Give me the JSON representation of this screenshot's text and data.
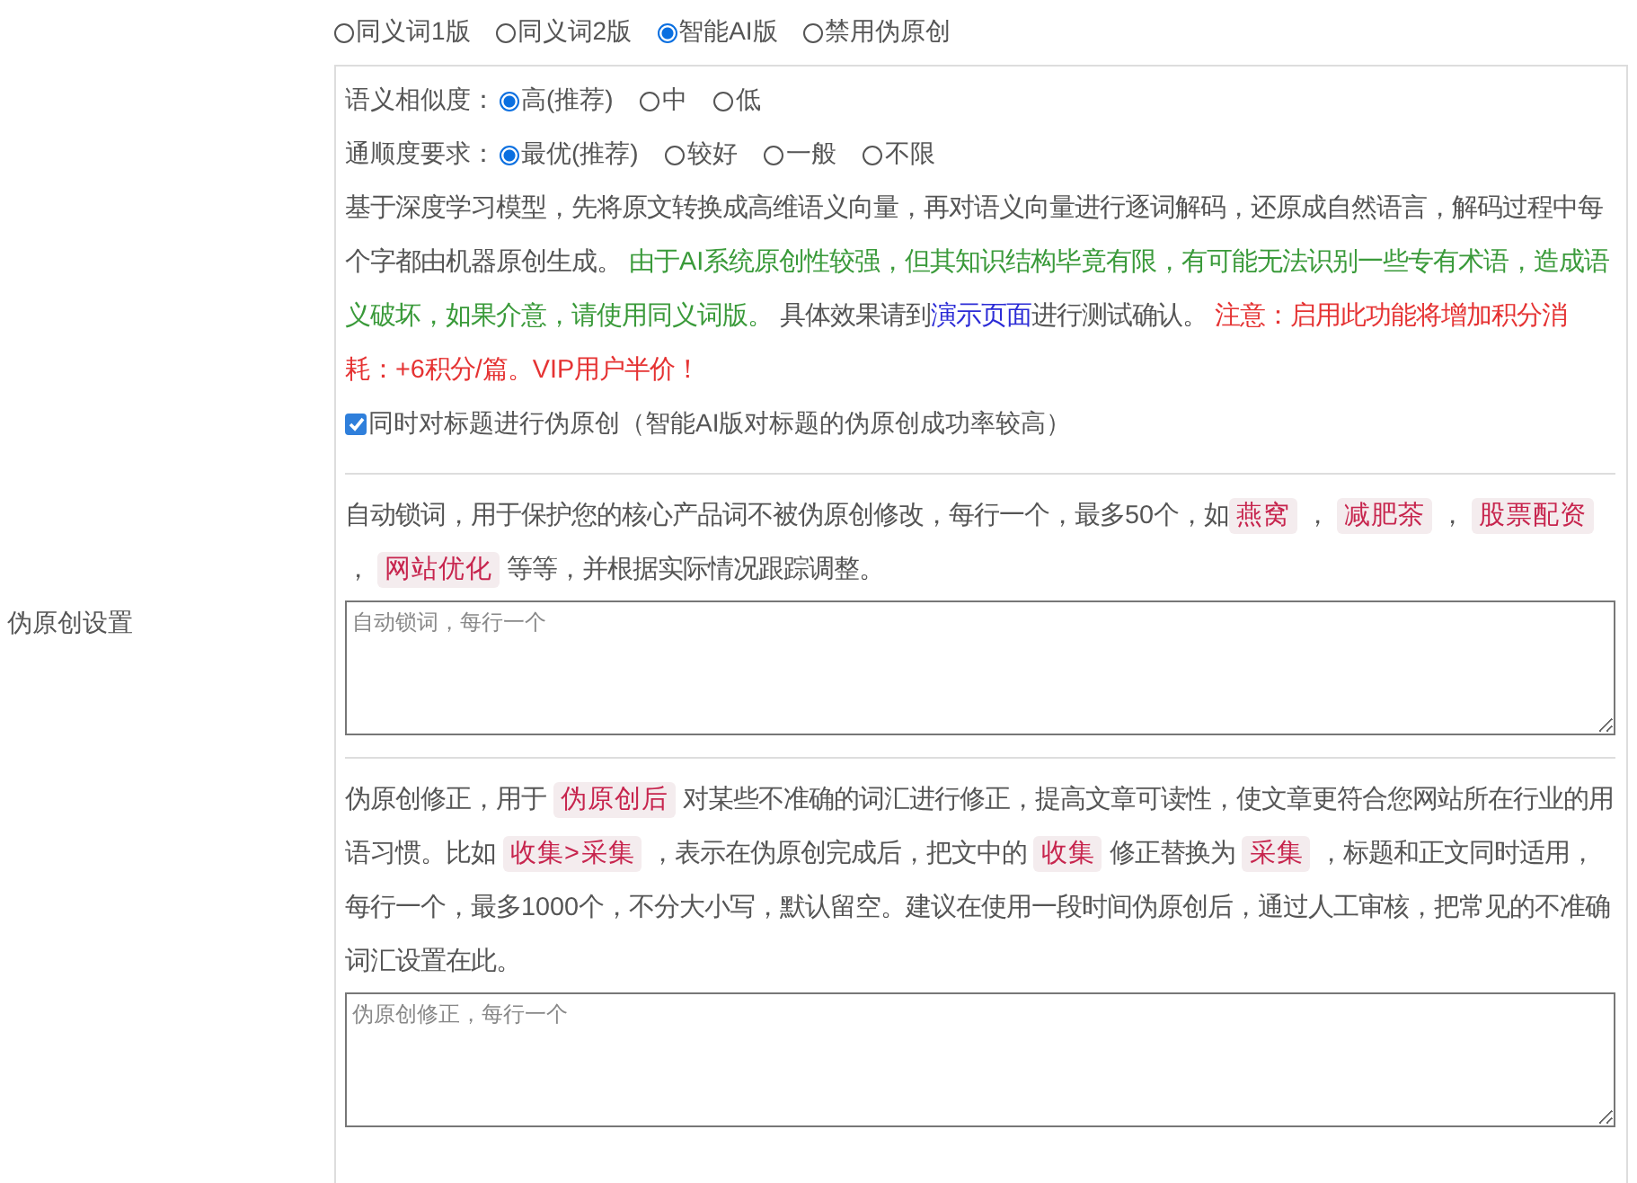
{
  "mode_options": [
    {
      "label": "同义词1版",
      "selected": false
    },
    {
      "label": "同义词2版",
      "selected": false
    },
    {
      "label": "智能AI版",
      "selected": true
    },
    {
      "label": "禁用伪原创",
      "selected": false
    }
  ],
  "section_label": "伪原创设置",
  "settings": [
    {
      "label": "语义相似度：",
      "options": [
        {
          "label": "高(推荐)",
          "selected": true
        },
        {
          "label": "中",
          "selected": false
        },
        {
          "label": "低",
          "selected": false
        }
      ]
    },
    {
      "label": "通顺度要求：",
      "options": [
        {
          "label": "最优(推荐)",
          "selected": true
        },
        {
          "label": "较好",
          "selected": false
        },
        {
          "label": "一般",
          "selected": false
        },
        {
          "label": "不限",
          "selected": false
        }
      ]
    }
  ],
  "description": [
    {
      "kind": "text",
      "text": "基于深度学习模型，先将原文转换成高维语义向量，再对语义向量进行逐词解码，还原成自然语言，解码过程中每个字都由机器原创生成。 "
    },
    {
      "kind": "green",
      "text": "由于AI系统原创性较强，但其知识结构毕竟有限，有可能无法识别一些专有术语，造成语义破坏，如果介意，请使用同义词版。"
    },
    {
      "kind": "text",
      "text": " 具体效果请到"
    },
    {
      "kind": "link",
      "text": "演示页面"
    },
    {
      "kind": "text",
      "text": "进行测试确认。 "
    },
    {
      "kind": "red",
      "text": "注意：启用此功能将增加积分消耗：+6积分/篇。VIP用户半价！"
    }
  ],
  "title_option": {
    "label": "同时对标题进行伪原创（智能AI版对标题的伪原创成功率较高）",
    "checked": true
  },
  "lock_words": {
    "description": [
      {
        "kind": "text",
        "text": "自动锁词，用于保护您的核心产品词不被伪原创修改，每行一个，最多50个，如"
      },
      {
        "kind": "code",
        "text": "燕窝"
      },
      {
        "kind": "text",
        "text": " ， "
      },
      {
        "kind": "code",
        "text": "减肥茶"
      },
      {
        "kind": "text",
        "text": " ， "
      },
      {
        "kind": "code",
        "text": "股票配资"
      },
      {
        "kind": "text",
        "text": " ， "
      },
      {
        "kind": "code",
        "text": "网站优化"
      },
      {
        "kind": "text",
        "text": " 等等，并根据实际情况跟踪调整。"
      }
    ],
    "placeholder": "自动锁词，每行一个"
  },
  "corrections": {
    "description": [
      {
        "kind": "text",
        "text": "伪原创修正，用于 "
      },
      {
        "kind": "code",
        "text": "伪原创后"
      },
      {
        "kind": "text",
        "text": " 对某些不准确的词汇进行修正，提高文章可读性，使文章更符合您网站所在行业的用语习惯。比如 "
      },
      {
        "kind": "code",
        "text": "收集>采集"
      },
      {
        "kind": "text",
        "text": " ，表示在伪原创完成后，把文中的 "
      },
      {
        "kind": "code",
        "text": "收集"
      },
      {
        "kind": "text",
        "text": " 修正替换为 "
      },
      {
        "kind": "code",
        "text": "采集"
      },
      {
        "kind": "text",
        "text": " ，标题和正文同时适用，每行一个，最多1000个，不分大小写，默认留空。建议在使用一段时间伪原创后，通过人工审核，把常见的不准确词汇设置在此。"
      }
    ],
    "placeholder": "伪原创修正，每行一个"
  }
}
